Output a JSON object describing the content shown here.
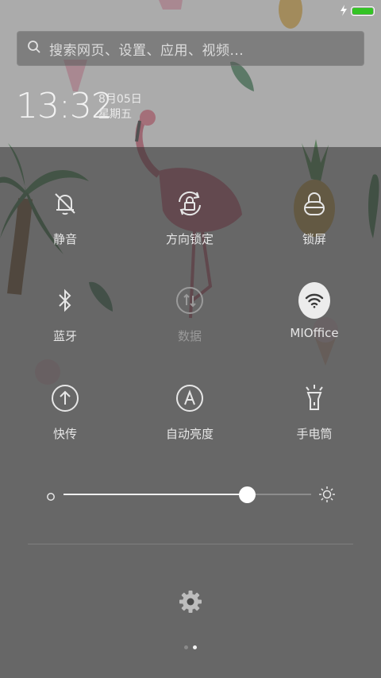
{
  "colors": {
    "accent_battery": "#34c325",
    "panel_overlay": "#464646",
    "icon": "#e6e6e6",
    "disabled": "#9a9a9a"
  },
  "status_bar": {
    "charging_icon": "lightning-icon",
    "battery_icon": "battery-icon",
    "battery_level": 1.0
  },
  "search": {
    "placeholder": "搜索网页、设置、应用、视频...",
    "icon": "search-icon"
  },
  "header": {
    "time": "13:32",
    "date": "8月05日",
    "weekday": "星期五"
  },
  "toggles": [
    {
      "label": "静音",
      "icon": "bell-off-icon",
      "state": "off"
    },
    {
      "label": "方向锁定",
      "icon": "rotation-lock-icon",
      "state": "off"
    },
    {
      "label": "锁屏",
      "icon": "lock-icon",
      "state": "off"
    },
    {
      "label": "蓝牙",
      "icon": "bluetooth-icon",
      "state": "off"
    },
    {
      "label": "数据",
      "icon": "mobile-data-icon",
      "state": "disabled"
    },
    {
      "label": "MIOffice",
      "icon": "wifi-icon",
      "state": "on"
    },
    {
      "label": "快传",
      "icon": "upload-icon",
      "state": "off"
    },
    {
      "label": "自动亮度",
      "icon": "auto-brightness-icon",
      "state": "off"
    },
    {
      "label": "手电筒",
      "icon": "flashlight-icon",
      "state": "off"
    }
  ],
  "brightness": {
    "value": 0.74,
    "min_icon": "brightness-low-icon",
    "max_icon": "brightness-high-icon"
  },
  "settings": {
    "icon": "gear-icon"
  },
  "pager": {
    "pages": 2,
    "current": 2
  }
}
